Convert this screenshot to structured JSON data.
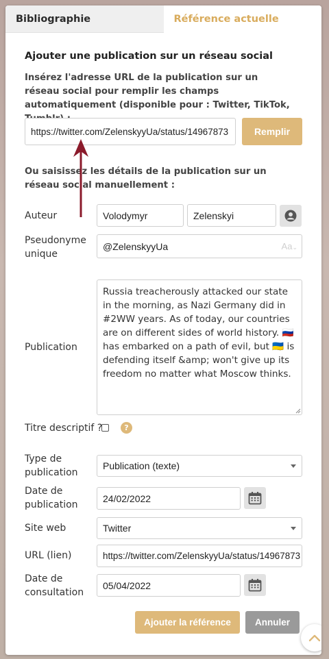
{
  "tabs": [
    {
      "label": "Bibliographie",
      "active": false
    },
    {
      "label": "Référence actuelle",
      "active": true
    }
  ],
  "section_title": "Ajouter une publication sur un réseau social",
  "url_instructions": "Insérez l'adresse URL de la publication sur un réseau social pour remplir les champs automatiquement (disponible pour : Twitter, TikTok, Tumblr) :",
  "url_input": {
    "value": "https://twitter.com/ZelenskyyUa/status/14967873"
  },
  "fill_button": "Remplir",
  "manual_instructions": "Ou saisissez les détails de la publication sur un réseau social manuellement :",
  "author": {
    "label": "Auteur",
    "first_name": "Volodymyr",
    "last_name": "Zelenskyi"
  },
  "handle": {
    "label": "Pseudonyme unique",
    "value": "@ZelenskyyUa",
    "format_icon": "Aa"
  },
  "publication": {
    "label": "Publication",
    "text": "Russia treacherously attacked our state in the morning, as Nazi Germany did in #2WW years. As of today, our countries are on different sides of world history. 🇷🇺 has embarked on a path of evil, but 🇺🇦 is defending itself &amp; won't give up its freedom no matter what Moscow thinks."
  },
  "descriptive_title": {
    "label": "Titre descriptif ?",
    "checked": false,
    "help": "?"
  },
  "pub_type": {
    "label": "Type de publication",
    "value": "Publication (texte)"
  },
  "pub_date": {
    "label": "Date de publication",
    "value": "24/02/2022"
  },
  "website": {
    "label": "Site web",
    "value": "Twitter"
  },
  "url_link": {
    "label": "URL (lien)",
    "value": "https://twitter.com/ZelenskyyUa/status/14967873"
  },
  "access_date": {
    "label": "Date de consultation",
    "value": "05/04/2022"
  },
  "add_button": "Ajouter la référence",
  "cancel_button": "Annuler",
  "colors": {
    "accent": "#deb97a",
    "accent_text": "#d9ac5d",
    "arrow": "#8b1a2b",
    "cancel": "#9a9a9a"
  }
}
